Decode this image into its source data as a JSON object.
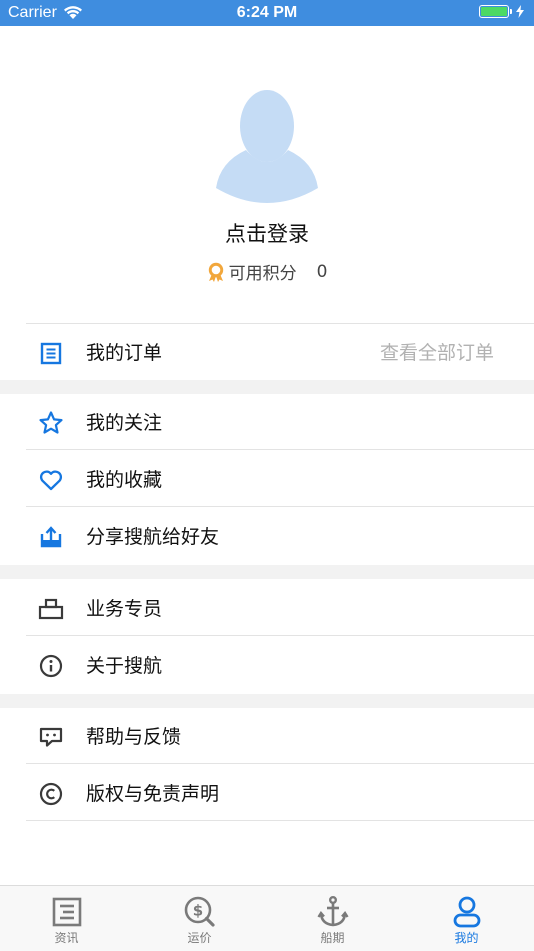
{
  "status_bar": {
    "carrier": "Carrier",
    "time": "6:24 PM"
  },
  "profile": {
    "login_text": "点击登录",
    "points_label": "可用积分",
    "points_value": "0"
  },
  "orders": {
    "label": "我的订单",
    "view_all": "查看全部订单"
  },
  "menu": {
    "follow": "我的关注",
    "favorites": "我的收藏",
    "share": "分享搜航给好友",
    "business": "业务专员",
    "about": "关于搜航",
    "feedback": "帮助与反馈",
    "copyright": "版权与免责声明"
  },
  "tabbar": {
    "tabs": [
      {
        "label": "资讯",
        "icon": "news-icon"
      },
      {
        "label": "运价",
        "icon": "freight-price-icon"
      },
      {
        "label": "船期",
        "icon": "anchor-icon"
      },
      {
        "label": "我的",
        "icon": "profile-icon"
      }
    ],
    "active_index": 3
  },
  "colors": {
    "accent": "#1677e0",
    "status_bar": "#3f8ddf",
    "avatar": "#c5dcf5",
    "battery": "#4cd964",
    "icon_dark": "#3a3a3a"
  }
}
